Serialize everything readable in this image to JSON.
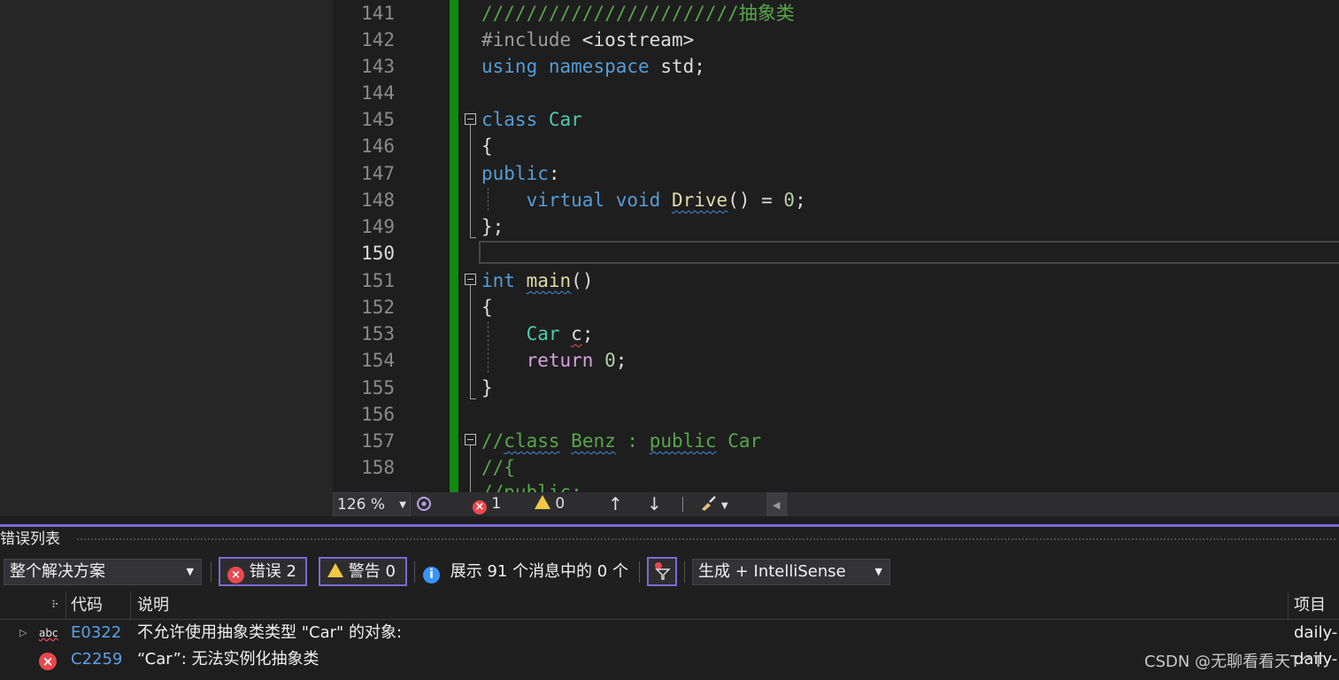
{
  "editor": {
    "line_numbers": [
      "141",
      "142",
      "143",
      "144",
      "145",
      "146",
      "147",
      "148",
      "149",
      "150",
      "151",
      "152",
      "153",
      "154",
      "155",
      "156",
      "157",
      "158"
    ],
    "partial_line": "//public:",
    "code": {
      "l141": "///////////////////////抽象类",
      "l142_pre": "#include ",
      "l142_hdr": "<iostream>",
      "l143_kw1": "using",
      "l143_kw2": "namespace",
      "l143_rest": " std;",
      "l145_kw": "class",
      "l145_ty": "Car",
      "brace_open": "{",
      "l147_kw": "public",
      "colon": ":",
      "l148_kw1": "virtual",
      "l148_kw2": "void",
      "l148_fn": "Drive",
      "l148_rest1": "() = ",
      "zero": "0",
      "semicolon": ";",
      "l149": "};",
      "l151_kw": "int",
      "l151_fn": "main",
      "parens": "()",
      "l153_ty": "Car",
      "l153_var": "c",
      "l154_kw": "return",
      "brace_close": "}",
      "l157_a": "//",
      "l157_b": "class",
      "l157_c": "Benz",
      "l157_d": " : ",
      "l157_e": "public",
      "l157_f": "Car",
      "l158": "//{"
    }
  },
  "status_bar": {
    "zoom": "126 %",
    "error_count": "1",
    "warning_count": "0",
    "up_arrow": "↑",
    "down_arrow": "↓"
  },
  "error_list": {
    "title": "错误列表",
    "scope": "整个解决方案",
    "errors_label": "错误 2",
    "warnings_label": "警告 0",
    "messages_label": "展示 91 个消息中的 0 个",
    "source_filter": "生成 + IntelliSense",
    "columns": {
      "code": "代码",
      "description": "说明",
      "project": "项目"
    },
    "rows": [
      {
        "code": "E0322",
        "description": "不允许使用抽象类类型 \"Car\" 的对象:",
        "project": "daily-"
      },
      {
        "code": "C2259",
        "description": "“Car”: 无法实例化抽象类",
        "project": "daily-"
      }
    ]
  },
  "watermark": "CSDN @无聊看看天T^T",
  "icons": [
    "error-icon",
    "warning-icon",
    "info-icon",
    "filter-icon",
    "brush-icon",
    "chevron-down-icon",
    "expand-arrow-icon",
    "spellcheck-icon",
    "up-arrow-icon",
    "down-arrow-icon"
  ],
  "colors": {
    "accent": "#7a6bd6",
    "error": "#e8484d",
    "warning": "#f2c744",
    "info": "#3794ff",
    "change_bar": "#108a10"
  }
}
